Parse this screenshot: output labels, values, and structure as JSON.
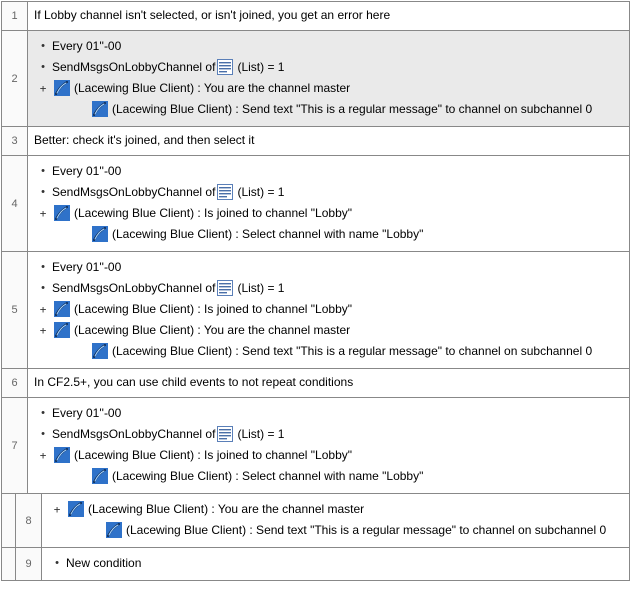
{
  "events": [
    {
      "num": "1",
      "type": "comment",
      "text": "If Lobby channel isn't selected, or isn't joined, you get an error here",
      "selected": false
    },
    {
      "num": "2",
      "type": "group",
      "selected": true,
      "conditions": [
        {
          "bullet": "•",
          "icon": null,
          "text": "Every 01''-00"
        },
        {
          "bullet": "•",
          "icon": "list",
          "text_pre": "SendMsgsOnLobbyChannel of ",
          "text_post": " (List) = 1"
        },
        {
          "bullet": "+",
          "icon": "lacewing",
          "text": "(Lacewing Blue Client) : You are the channel master"
        }
      ],
      "actions": [
        {
          "icon": "lacewing",
          "text": "(Lacewing Blue Client) : Send text \"This is a regular message\" to channel on subchannel 0"
        }
      ]
    },
    {
      "num": "3",
      "type": "comment",
      "text": "Better: check it's joined, and then select it",
      "selected": false
    },
    {
      "num": "4",
      "type": "group",
      "selected": false,
      "conditions": [
        {
          "bullet": "•",
          "icon": null,
          "text": "Every 01''-00"
        },
        {
          "bullet": "•",
          "icon": "list",
          "text_pre": "SendMsgsOnLobbyChannel of ",
          "text_post": " (List) = 1"
        },
        {
          "bullet": "+",
          "icon": "lacewing",
          "text": "(Lacewing Blue Client) : Is joined to channel \"Lobby\""
        }
      ],
      "actions": [
        {
          "icon": "lacewing",
          "text": "(Lacewing Blue Client) : Select channel with name \"Lobby\""
        }
      ]
    },
    {
      "num": "5",
      "type": "group",
      "selected": false,
      "conditions": [
        {
          "bullet": "•",
          "icon": null,
          "text": "Every 01''-00"
        },
        {
          "bullet": "•",
          "icon": "list",
          "text_pre": "SendMsgsOnLobbyChannel of ",
          "text_post": " (List) = 1"
        },
        {
          "bullet": "+",
          "icon": "lacewing",
          "text": "(Lacewing Blue Client) : Is joined to channel \"Lobby\""
        },
        {
          "bullet": "+",
          "icon": "lacewing",
          "text": "(Lacewing Blue Client) : You are the channel master"
        }
      ],
      "actions": [
        {
          "icon": "lacewing",
          "text": "(Lacewing Blue Client) : Send text \"This is a regular message\" to channel on subchannel 0"
        }
      ]
    },
    {
      "num": "6",
      "type": "comment",
      "text": "In CF2.5+, you can use child events to not repeat conditions",
      "selected": false
    },
    {
      "num": "7",
      "type": "group",
      "selected": false,
      "conditions": [
        {
          "bullet": "•",
          "icon": null,
          "text": "Every 01''-00"
        },
        {
          "bullet": "•",
          "icon": "list",
          "text_pre": "SendMsgsOnLobbyChannel of ",
          "text_post": " (List) = 1"
        },
        {
          "bullet": "+",
          "icon": "lacewing",
          "text": "(Lacewing Blue Client) : Is joined to channel \"Lobby\""
        }
      ],
      "actions": [
        {
          "icon": "lacewing",
          "text": "(Lacewing Blue Client) : Select channel with name \"Lobby\""
        }
      ]
    },
    {
      "num": "8",
      "type": "child-group",
      "selected": false,
      "conditions": [
        {
          "bullet": "+",
          "icon": "lacewing",
          "text": "(Lacewing Blue Client) : You are the channel master"
        }
      ],
      "actions": [
        {
          "icon": "lacewing",
          "text": "(Lacewing Blue Client) : Send text \"This is a regular message\" to channel on subchannel 0"
        }
      ]
    },
    {
      "num": "9",
      "type": "child-new",
      "selected": false,
      "conditions": [
        {
          "bullet": "•",
          "icon": null,
          "text": "New condition"
        }
      ],
      "actions": []
    }
  ]
}
